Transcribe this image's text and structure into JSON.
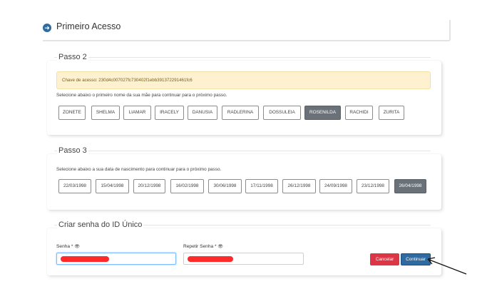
{
  "header": {
    "title": "Primeiro Acesso",
    "icon": "arrow-right-circle-icon"
  },
  "step2": {
    "legend": "Passo 2",
    "alert": "Chave de acesso: 230d4c007027fc730402f1ebb391372291461fc6",
    "instruction": "Selecione abaixo o primeiro nome da sua mãe para continuar para o próximo passo.",
    "options": [
      "ZONETE",
      "SHELMA",
      "LIAMAR",
      "IRACELY",
      "DANUSIA",
      "RADLERINA",
      "DOSSULEIA",
      "ROSENILDA",
      "RACHIDI",
      "ZURITA"
    ],
    "selected": "ROSENILDA"
  },
  "step3": {
    "legend": "Passo 3",
    "instruction": "Selecione abaixo a sua data de nascimento para continuar para o próximo passo.",
    "options": [
      "22/03/1998",
      "15/04/1998",
      "20/12/1998",
      "16/02/1998",
      "30/06/1998",
      "17/11/1998",
      "26/12/1998",
      "24/09/1998",
      "23/12/1998",
      "26/04/1998"
    ],
    "selected": "26/04/1998"
  },
  "password": {
    "legend": "Criar senha do ID Único",
    "senha_label": "Senha *",
    "repetir_label": "Repetir Senha *",
    "cancel_label": "Cancelar",
    "continue_label": "Continuar"
  },
  "colors": {
    "primary": "#2f6aa0",
    "danger": "#dc3545",
    "selected": "#6b7178",
    "alert_bg": "#fdf1cf",
    "mask": "#ff2a2a"
  }
}
